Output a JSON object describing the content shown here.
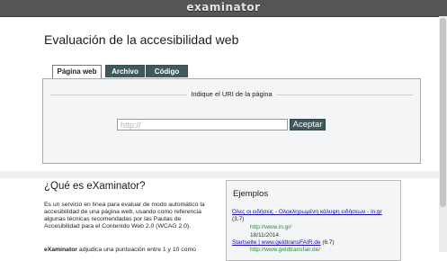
{
  "header": {
    "logo": "examinator"
  },
  "main": {
    "title": "Evaluación de la accesibilidad web",
    "tabs": [
      {
        "label": "Página web",
        "active": true
      },
      {
        "label": "Archivo",
        "active": false
      },
      {
        "label": "Código",
        "active": false
      }
    ],
    "form": {
      "legend": "Indique el URI de la página",
      "input_placeholder": "http://",
      "input_value": "",
      "submit_label": "Aceptar"
    }
  },
  "about": {
    "title": "¿Qué es eXaminator?",
    "text": "Es un servicio en línea para evaluar de modo automático la accesibilidad de una página web, usando como referencia algunas técnicas recomendadas por las Pautas de Accesibilidad para el Contenido Web 2.0 (WCAG 2.0).",
    "text2_bold": "eXaminator",
    "text2_rest": " adjudica una puntuación entre 1 y 10 como"
  },
  "examples": {
    "title": "Ejemplos",
    "items": [
      {
        "link": "Όλες οι ειδήσεις - Ολοκληρωμένη κάλυψη ειδήσεων - in.gr",
        "score": "(3.7)",
        "url": "http://www.in.gr/",
        "date": "18/11/2014"
      },
      {
        "link": "Startseite | www.geldtransFAIR.de",
        "score": "(6.7)",
        "url": "http://www.geldtransfair.de/",
        "date": ""
      }
    ]
  },
  "colors": {
    "header_bg": "#555555",
    "tab_bg": "#3e5a5d",
    "link": "#1a0dab",
    "url_green": "#2b8a3e",
    "panel_bg": "#f4f5f7"
  }
}
